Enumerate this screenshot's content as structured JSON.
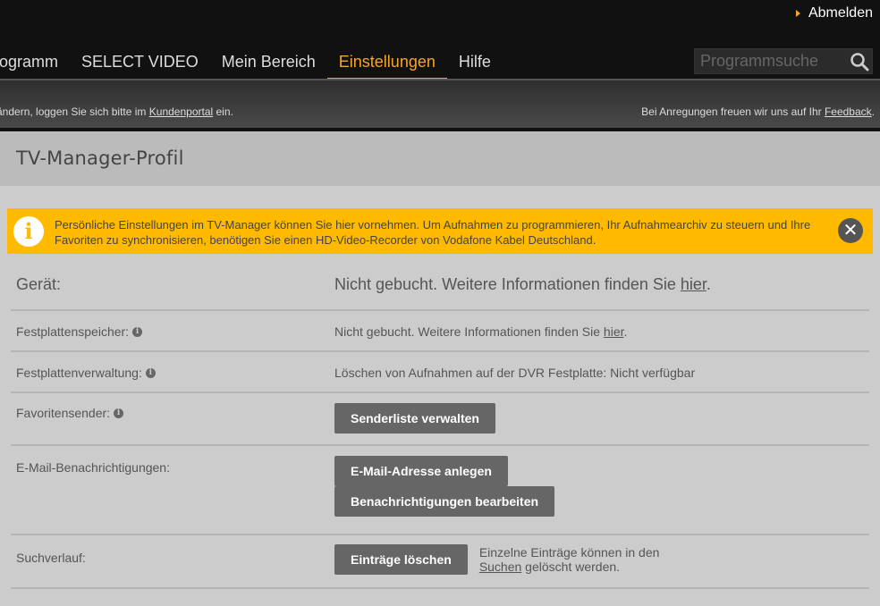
{
  "header": {
    "logout_label": "Abmelden",
    "nav": [
      {
        "label": "ogramm"
      },
      {
        "label": "SELECT VIDEO"
      },
      {
        "label": "Mein Bereich"
      },
      {
        "label": "Einstellungen",
        "active": true
      },
      {
        "label": "Hilfe"
      }
    ],
    "search_placeholder": "Programmsuche",
    "subbar_left_prefix": "ändern, loggen Sie sich bitte im ",
    "subbar_left_link": "Kundenportal",
    "subbar_left_suffix": " ein.",
    "subbar_right_prefix": "Bei Anregungen freuen wir uns auf Ihr ",
    "subbar_right_link": "Feedback",
    "subbar_right_suffix": "."
  },
  "page_title": "TV-Manager-Profil",
  "notice": {
    "text": "Persönliche Einstellungen im TV-Manager können Sie hier vornehmen. Um Aufnahmen zu programmieren, Ihr Aufnahmearchiv zu steuern und Ihre Favoriten zu synchronisieren, benötigen Sie einen HD-Video-Recorder von Vodafone Kabel Deutschland."
  },
  "rows": {
    "geraet": {
      "label": "Gerät:",
      "value_prefix": "Nicht gebucht. Weitere Informationen finden Sie ",
      "link": "hier",
      "suffix": "."
    },
    "festplattenspeicher": {
      "label": "Festplattenspeicher:",
      "value_prefix": "Nicht gebucht. Weitere Informationen finden Sie ",
      "link": "hier",
      "suffix": "."
    },
    "festplattenverwaltung": {
      "label": "Festplattenverwaltung:",
      "value": "Löschen von Aufnahmen auf der DVR Festplatte: Nicht verfügbar"
    },
    "favoritensender": {
      "label": "Favoritensender:",
      "button": "Senderliste verwalten"
    },
    "email": {
      "label": "E-Mail-Benachrichtigungen:",
      "button1": "E-Mail-Adresse anlegen",
      "button2": "Benachrichtigungen bearbeiten"
    },
    "suchverlauf": {
      "label": "Suchverlauf:",
      "button": "Einträge löschen",
      "hint_line1": "Einzelne Einträge können in den",
      "hint_link": "Suchen",
      "hint_suffix": " gelöscht werden."
    }
  },
  "colors": {
    "accent": "#f5a623",
    "notice_bg": "#ffba00",
    "button_bg": "#666666"
  }
}
